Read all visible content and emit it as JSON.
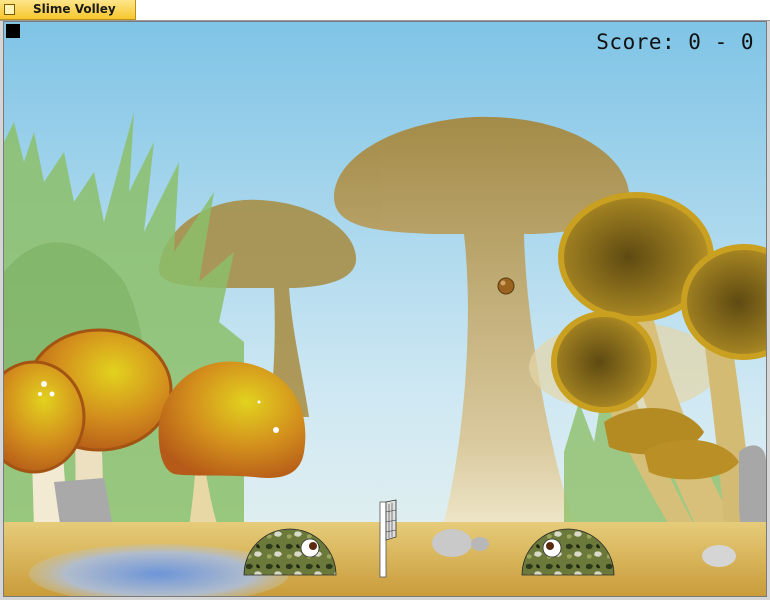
{
  "window": {
    "title": "Slime Volley"
  },
  "hud": {
    "score_text": "Score: 0 - 0",
    "player_score": 0,
    "opponent_score": 0
  },
  "colors": {
    "sky_top": "#7fc4e6",
    "sky_bottom": "#d8ecf4",
    "ground": "#d8b55c",
    "mushroom_silhouette": "#9b7a2c",
    "mushroom_cap_orange": "#c7781a",
    "mushroom_cap_gold": "#c9a020",
    "grass": "#8cc06a",
    "title_tab": "#f7c62e"
  },
  "icons": {
    "window_icon": "square-icon",
    "menu": "black-square-icon"
  }
}
